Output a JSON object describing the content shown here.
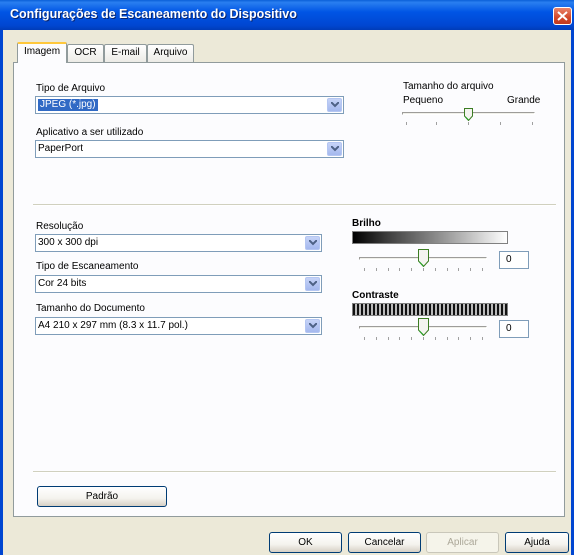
{
  "window": {
    "title": "Configurações de Escaneamento do Dispositivo"
  },
  "tabs": [
    "Imagem",
    "OCR",
    "E-mail",
    "Arquivo"
  ],
  "file_type": {
    "label": "Tipo de Arquivo",
    "value": "JPEG (*.jpg)"
  },
  "app": {
    "label": "Aplicativo a ser utilizado",
    "value": "PaperPort"
  },
  "file_size": {
    "label": "Tamanho do arquivo",
    "min_label": "Pequeno",
    "max_label": "Grande",
    "level": 0.5
  },
  "resolution": {
    "label": "Resolução",
    "value": "300 x 300 dpi"
  },
  "scan_type": {
    "label": "Tipo de Escaneamento",
    "value": "Cor 24 bits"
  },
  "doc_size": {
    "label": "Tamanho do Documento",
    "value": "A4 210 x 297 mm (8.3 x 11.7 pol.)"
  },
  "brightness": {
    "label": "Brilho",
    "value": "0",
    "level": 0.5
  },
  "contrast": {
    "label": "Contraste",
    "value": "0",
    "level": 0.5
  },
  "buttons": {
    "default": "Padrão",
    "ok": "OK",
    "cancel": "Cancelar",
    "apply": "Aplicar",
    "help": "Ajuda"
  },
  "colors": {
    "titlebar": "#0054E3",
    "selection": "#316AC5",
    "tab_highlight": "#FFC83C"
  }
}
